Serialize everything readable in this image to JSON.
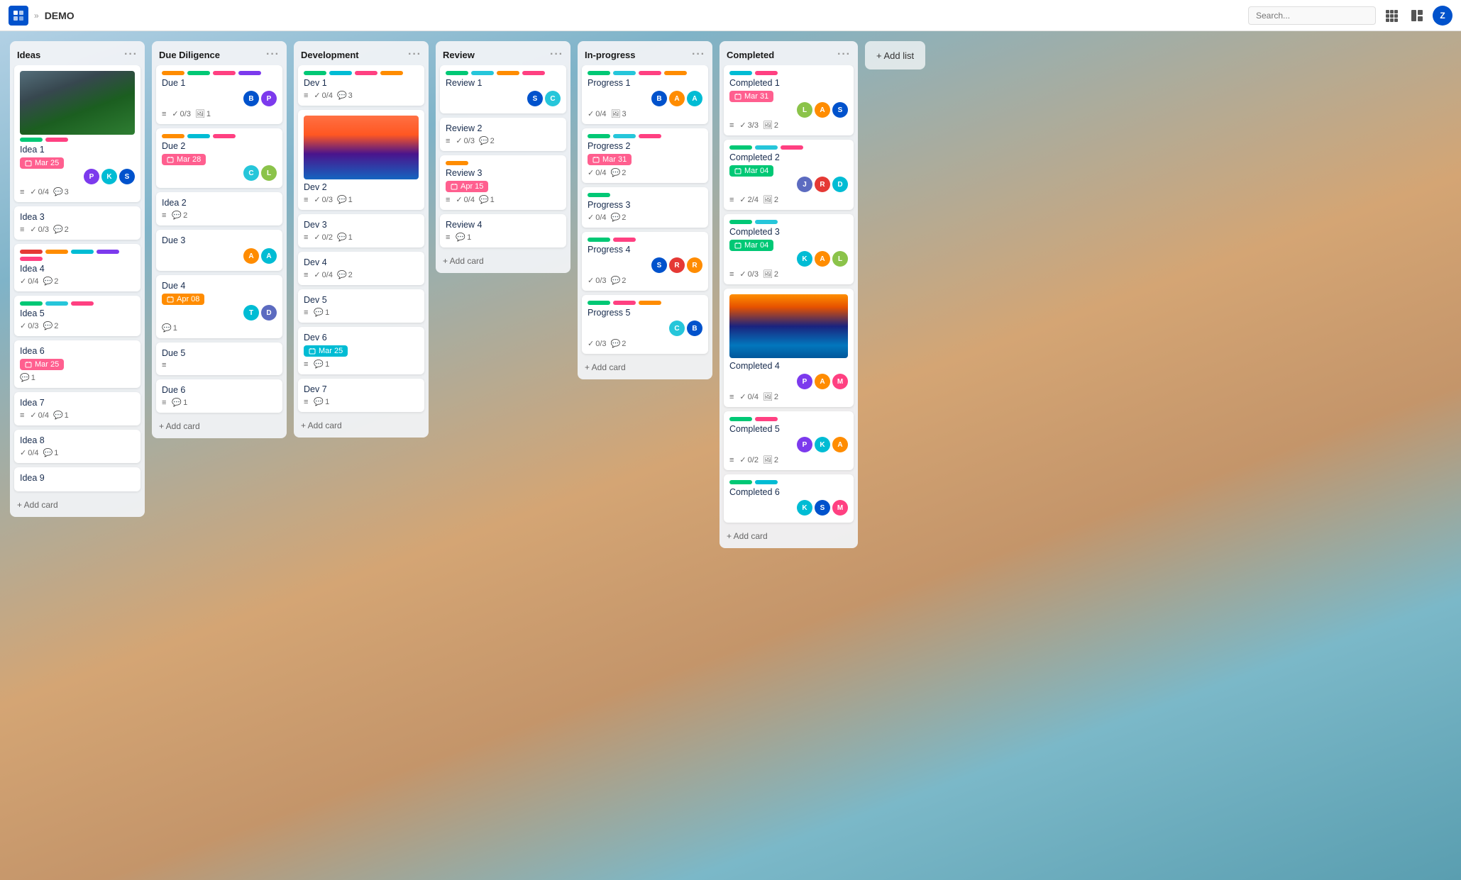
{
  "app": {
    "logo": "✓",
    "breadcrumb_sep": "»",
    "title": "DEMO",
    "search_placeholder": "Search...",
    "grid_icon": "⊞",
    "user_initial": "Z"
  },
  "add_list_label": "+ Add list",
  "lists": [
    {
      "id": "ideas",
      "title": "Ideas",
      "cards": [
        {
          "id": "idea1",
          "title": "Idea 1",
          "has_image": true,
          "image_type": "ideas",
          "tags": [
            "#00c875",
            "#ff4081"
          ],
          "date_badge": {
            "label": "Mar 25",
            "style": "pink"
          },
          "avatars": [
            {
              "initial": "P",
              "color": "av-purple"
            },
            {
              "initial": "K",
              "color": "av-teal"
            },
            {
              "initial": "S",
              "color": "av-blue"
            }
          ],
          "meta": [
            {
              "icon": "≡",
              "val": ""
            },
            {
              "icon": "✓",
              "val": "0/4"
            },
            {
              "icon": "💬",
              "val": "3"
            }
          ]
        },
        {
          "id": "idea3",
          "title": "Idea 3",
          "tags": [],
          "meta": [
            {
              "icon": "≡",
              "val": ""
            },
            {
              "icon": "✓",
              "val": "0/3"
            },
            {
              "icon": "💬",
              "val": "2"
            }
          ]
        },
        {
          "id": "idea4",
          "title": "Idea 4",
          "tags": [
            "#e53935",
            "#ff8c00",
            "#00bcd4",
            "#7c3aed",
            "#ff4081"
          ],
          "meta": [
            {
              "icon": "✓",
              "val": "0/4"
            },
            {
              "icon": "💬",
              "val": "2"
            }
          ]
        },
        {
          "id": "idea5",
          "title": "Idea 5",
          "tags": [
            "#00c875",
            "#26c6da",
            "#ff4081"
          ],
          "meta": [
            {
              "icon": "✓",
              "val": "0/3"
            },
            {
              "icon": "💬",
              "val": "2"
            }
          ]
        },
        {
          "id": "idea6",
          "title": "Idea 6",
          "date_badge": {
            "label": "Mar 25",
            "style": "pink"
          },
          "meta": [
            {
              "icon": "💬",
              "val": "1"
            }
          ]
        },
        {
          "id": "idea7",
          "title": "Idea 7",
          "meta": [
            {
              "icon": "≡",
              "val": ""
            },
            {
              "icon": "✓",
              "val": "0/4"
            },
            {
              "icon": "💬",
              "val": "1"
            }
          ]
        },
        {
          "id": "idea8",
          "title": "Idea 8",
          "meta": [
            {
              "icon": "✓",
              "val": "0/4"
            },
            {
              "icon": "💬",
              "val": "1"
            }
          ]
        },
        {
          "id": "idea9",
          "title": "Idea 9",
          "meta": []
        }
      ],
      "add_label": "+ Add card"
    },
    {
      "id": "due-diligence",
      "title": "Due Diligence",
      "cards": [
        {
          "id": "due1",
          "title": "Due 1",
          "tags": [
            "#ff8c00",
            "#00c875",
            "#ff4081",
            "#7c3aed"
          ],
          "avatars": [
            {
              "initial": "B",
              "color": "av-blue"
            },
            {
              "initial": "P",
              "color": "av-purple"
            }
          ],
          "meta": [
            {
              "icon": "≡",
              "val": ""
            },
            {
              "icon": "✓",
              "val": "0/3"
            },
            {
              "icon": "🖼",
              "val": "1"
            }
          ]
        },
        {
          "id": "due2",
          "title": "Due 2",
          "tags": [
            "#ff8c00",
            "#00bcd4",
            "#ff4081"
          ],
          "date_badge": {
            "label": "Mar 28",
            "style": "pink"
          },
          "avatars": [
            {
              "initial": "C",
              "color": "av-cyan"
            },
            {
              "initial": "L",
              "color": "av-lime"
            }
          ],
          "meta": []
        },
        {
          "id": "idea2-dd",
          "title": "Idea 2",
          "meta": [
            {
              "icon": "≡",
              "val": ""
            },
            {
              "icon": "💬",
              "val": "2"
            }
          ]
        },
        {
          "id": "due3",
          "title": "Due 3",
          "tags": [],
          "avatars": [
            {
              "initial": "A",
              "color": "av-orange"
            },
            {
              "initial": "A",
              "color": "av-teal"
            }
          ],
          "meta": []
        },
        {
          "id": "due4",
          "title": "Due 4",
          "date_badge": {
            "label": "Apr 08",
            "style": "orange"
          },
          "avatars": [
            {
              "initial": "T",
              "color": "av-teal"
            },
            {
              "initial": "D",
              "color": "av-deep"
            }
          ],
          "meta": [
            {
              "icon": "💬",
              "val": "1"
            }
          ]
        },
        {
          "id": "due5",
          "title": "Due 5",
          "meta": [
            {
              "icon": "≡",
              "val": ""
            }
          ]
        },
        {
          "id": "due6",
          "title": "Due 6",
          "meta": [
            {
              "icon": "≡",
              "val": ""
            },
            {
              "icon": "💬",
              "val": "1"
            }
          ]
        }
      ],
      "add_label": "+ Add card"
    },
    {
      "id": "development",
      "title": "Development",
      "cards": [
        {
          "id": "dev1",
          "title": "Dev 1",
          "tags": [
            "#00c875",
            "#00bcd4",
            "#ff4081",
            "#ff8c00"
          ],
          "meta": [
            {
              "icon": "≡",
              "val": ""
            },
            {
              "icon": "✓",
              "val": "0/4"
            },
            {
              "icon": "💬",
              "val": "3"
            }
          ]
        },
        {
          "id": "dev2",
          "title": "Dev 2",
          "has_image": true,
          "image_type": "mountain",
          "meta": [
            {
              "icon": "≡",
              "val": ""
            },
            {
              "icon": "✓",
              "val": "0/3"
            },
            {
              "icon": "💬",
              "val": "1"
            }
          ]
        },
        {
          "id": "dev3",
          "title": "Dev 3",
          "meta": [
            {
              "icon": "≡",
              "val": ""
            },
            {
              "icon": "✓",
              "val": "0/2"
            },
            {
              "icon": "💬",
              "val": "1"
            }
          ]
        },
        {
          "id": "dev4",
          "title": "Dev 4",
          "meta": [
            {
              "icon": "≡",
              "val": ""
            },
            {
              "icon": "✓",
              "val": "0/4"
            },
            {
              "icon": "💬",
              "val": "2"
            }
          ]
        },
        {
          "id": "dev5",
          "title": "Dev 5",
          "meta": [
            {
              "icon": "≡",
              "val": ""
            },
            {
              "icon": "💬",
              "val": "1"
            }
          ]
        },
        {
          "id": "dev6",
          "title": "Dev 6",
          "date_badge": {
            "label": "Mar 25",
            "style": "teal"
          },
          "meta": [
            {
              "icon": "≡",
              "val": ""
            },
            {
              "icon": "💬",
              "val": "1"
            }
          ]
        },
        {
          "id": "dev7",
          "title": "Dev 7",
          "meta": [
            {
              "icon": "≡",
              "val": ""
            },
            {
              "icon": "💬",
              "val": "1"
            }
          ]
        }
      ],
      "add_label": "+ Add card"
    },
    {
      "id": "review",
      "title": "Review",
      "cards": [
        {
          "id": "review1",
          "title": "Review 1",
          "tags": [
            "#00c875",
            "#26c6da",
            "#ff8c00",
            "#ff4081"
          ],
          "avatars": [
            {
              "initial": "S",
              "color": "av-blue"
            },
            {
              "initial": "C",
              "color": "av-cyan"
            }
          ],
          "meta": []
        },
        {
          "id": "review2",
          "title": "Review 2",
          "meta": [
            {
              "icon": "≡",
              "val": ""
            },
            {
              "icon": "✓",
              "val": "0/3"
            },
            {
              "icon": "💬",
              "val": "2"
            }
          ]
        },
        {
          "id": "review3",
          "title": "Review 3",
          "tags": [
            "#ff8c00"
          ],
          "date_badge": {
            "label": "Apr 15",
            "style": "pink"
          },
          "meta": [
            {
              "icon": "≡",
              "val": ""
            },
            {
              "icon": "✓",
              "val": "0/4"
            },
            {
              "icon": "💬",
              "val": "1"
            }
          ]
        },
        {
          "id": "review4",
          "title": "Review 4",
          "meta": [
            {
              "icon": "≡",
              "val": ""
            },
            {
              "icon": "💬",
              "val": "1"
            }
          ]
        }
      ],
      "add_label": "+ Add card"
    },
    {
      "id": "in-progress",
      "title": "In-progress",
      "cards": [
        {
          "id": "progress1",
          "title": "Progress 1",
          "tags": [
            "#00c875",
            "#26c6da",
            "#ff4081",
            "#ff8c00"
          ],
          "avatars": [
            {
              "initial": "B",
              "color": "av-blue"
            },
            {
              "initial": "A",
              "color": "av-orange"
            },
            {
              "initial": "A",
              "color": "av-teal"
            }
          ],
          "meta": [
            {
              "icon": "✓",
              "val": "0/4"
            },
            {
              "icon": "🖼",
              "val": "3"
            }
          ]
        },
        {
          "id": "progress2",
          "title": "Progress 2",
          "tags": [
            "#00c875",
            "#26c6da",
            "#ff4081"
          ],
          "date_badge": {
            "label": "Mar 31",
            "style": "pink"
          },
          "meta": [
            {
              "icon": "✓",
              "val": "0/4"
            },
            {
              "icon": "💬",
              "val": "2"
            }
          ]
        },
        {
          "id": "progress3",
          "title": "Progress 3",
          "tags": [
            "#00c875"
          ],
          "meta": [
            {
              "icon": "✓",
              "val": "0/4"
            },
            {
              "icon": "💬",
              "val": "2"
            }
          ]
        },
        {
          "id": "progress4",
          "title": "Progress 4",
          "tags": [
            "#00c875",
            "#ff4081"
          ],
          "avatars": [
            {
              "initial": "S",
              "color": "av-blue"
            },
            {
              "initial": "R",
              "color": "av-red"
            },
            {
              "initial": "R",
              "color": "av-orange"
            }
          ],
          "meta": [
            {
              "icon": "✓",
              "val": "0/3"
            },
            {
              "icon": "💬",
              "val": "2"
            }
          ]
        },
        {
          "id": "progress5",
          "title": "Progress 5",
          "tags": [
            "#00c875",
            "#ff4081",
            "#ff8c00"
          ],
          "avatars": [
            {
              "initial": "C",
              "color": "av-cyan"
            },
            {
              "initial": "B",
              "color": "av-blue"
            }
          ],
          "meta": [
            {
              "icon": "✓",
              "val": "0/3"
            },
            {
              "icon": "💬",
              "val": "2"
            }
          ]
        }
      ],
      "add_label": "+ Add card"
    },
    {
      "id": "completed",
      "title": "Completed",
      "cards": [
        {
          "id": "completed1",
          "title": "Completed 1",
          "tags": [
            "#00bcd4",
            "#ff4081"
          ],
          "date_badge": {
            "label": "Mar 31",
            "style": "pink"
          },
          "avatars": [
            {
              "initial": "L",
              "color": "av-lime"
            },
            {
              "initial": "A",
              "color": "av-orange"
            },
            {
              "initial": "S",
              "color": "av-blue"
            }
          ],
          "meta": [
            {
              "icon": "≡",
              "val": ""
            },
            {
              "icon": "✓",
              "val": "3/3"
            },
            {
              "icon": "🖼",
              "val": "2"
            }
          ]
        },
        {
          "id": "completed2",
          "title": "Completed 2",
          "tags": [
            "#00c875",
            "#26c6da",
            "#ff4081"
          ],
          "date_badge": {
            "label": "Mar 04",
            "style": "green"
          },
          "avatars": [
            {
              "initial": "J",
              "color": "av-deep"
            },
            {
              "initial": "R",
              "color": "av-red"
            },
            {
              "initial": "D",
              "color": "av-teal"
            }
          ],
          "meta": [
            {
              "icon": "≡",
              "val": ""
            },
            {
              "icon": "✓",
              "val": "2/4"
            },
            {
              "icon": "🖼",
              "val": "2"
            }
          ]
        },
        {
          "id": "completed3",
          "title": "Completed 3",
          "tags": [
            "#00c875",
            "#26c6da"
          ],
          "date_badge": {
            "label": "Mar 04",
            "style": "green"
          },
          "avatars": [
            {
              "initial": "K",
              "color": "av-teal"
            },
            {
              "initial": "A",
              "color": "av-orange"
            },
            {
              "initial": "L",
              "color": "av-lime"
            }
          ],
          "meta": [
            {
              "icon": "≡",
              "val": ""
            },
            {
              "icon": "✓",
              "val": "0/3"
            },
            {
              "icon": "🖼",
              "val": "2"
            }
          ]
        },
        {
          "id": "completed4",
          "title": "Completed 4",
          "has_image": true,
          "image_type": "lake",
          "avatars": [
            {
              "initial": "P",
              "color": "av-purple"
            },
            {
              "initial": "A",
              "color": "av-orange"
            },
            {
              "initial": "M",
              "color": "av-pink"
            }
          ],
          "meta": [
            {
              "icon": "≡",
              "val": ""
            },
            {
              "icon": "✓",
              "val": "0/4"
            },
            {
              "icon": "🖼",
              "val": "2"
            }
          ]
        },
        {
          "id": "completed5",
          "title": "Completed 5",
          "tags": [
            "#00c875",
            "#ff4081"
          ],
          "avatars": [
            {
              "initial": "P",
              "color": "av-purple"
            },
            {
              "initial": "K",
              "color": "av-teal"
            },
            {
              "initial": "A",
              "color": "av-orange"
            }
          ],
          "meta": [
            {
              "icon": "≡",
              "val": ""
            },
            {
              "icon": "✓",
              "val": "0/2"
            },
            {
              "icon": "🖼",
              "val": "2"
            }
          ]
        },
        {
          "id": "completed6",
          "title": "Completed 6",
          "tags": [
            "#00c875",
            "#00bcd4"
          ],
          "avatars": [
            {
              "initial": "K",
              "color": "av-teal"
            },
            {
              "initial": "S",
              "color": "av-blue"
            },
            {
              "initial": "M",
              "color": "av-pink"
            }
          ],
          "meta": []
        }
      ],
      "add_label": "+ Add card"
    }
  ]
}
